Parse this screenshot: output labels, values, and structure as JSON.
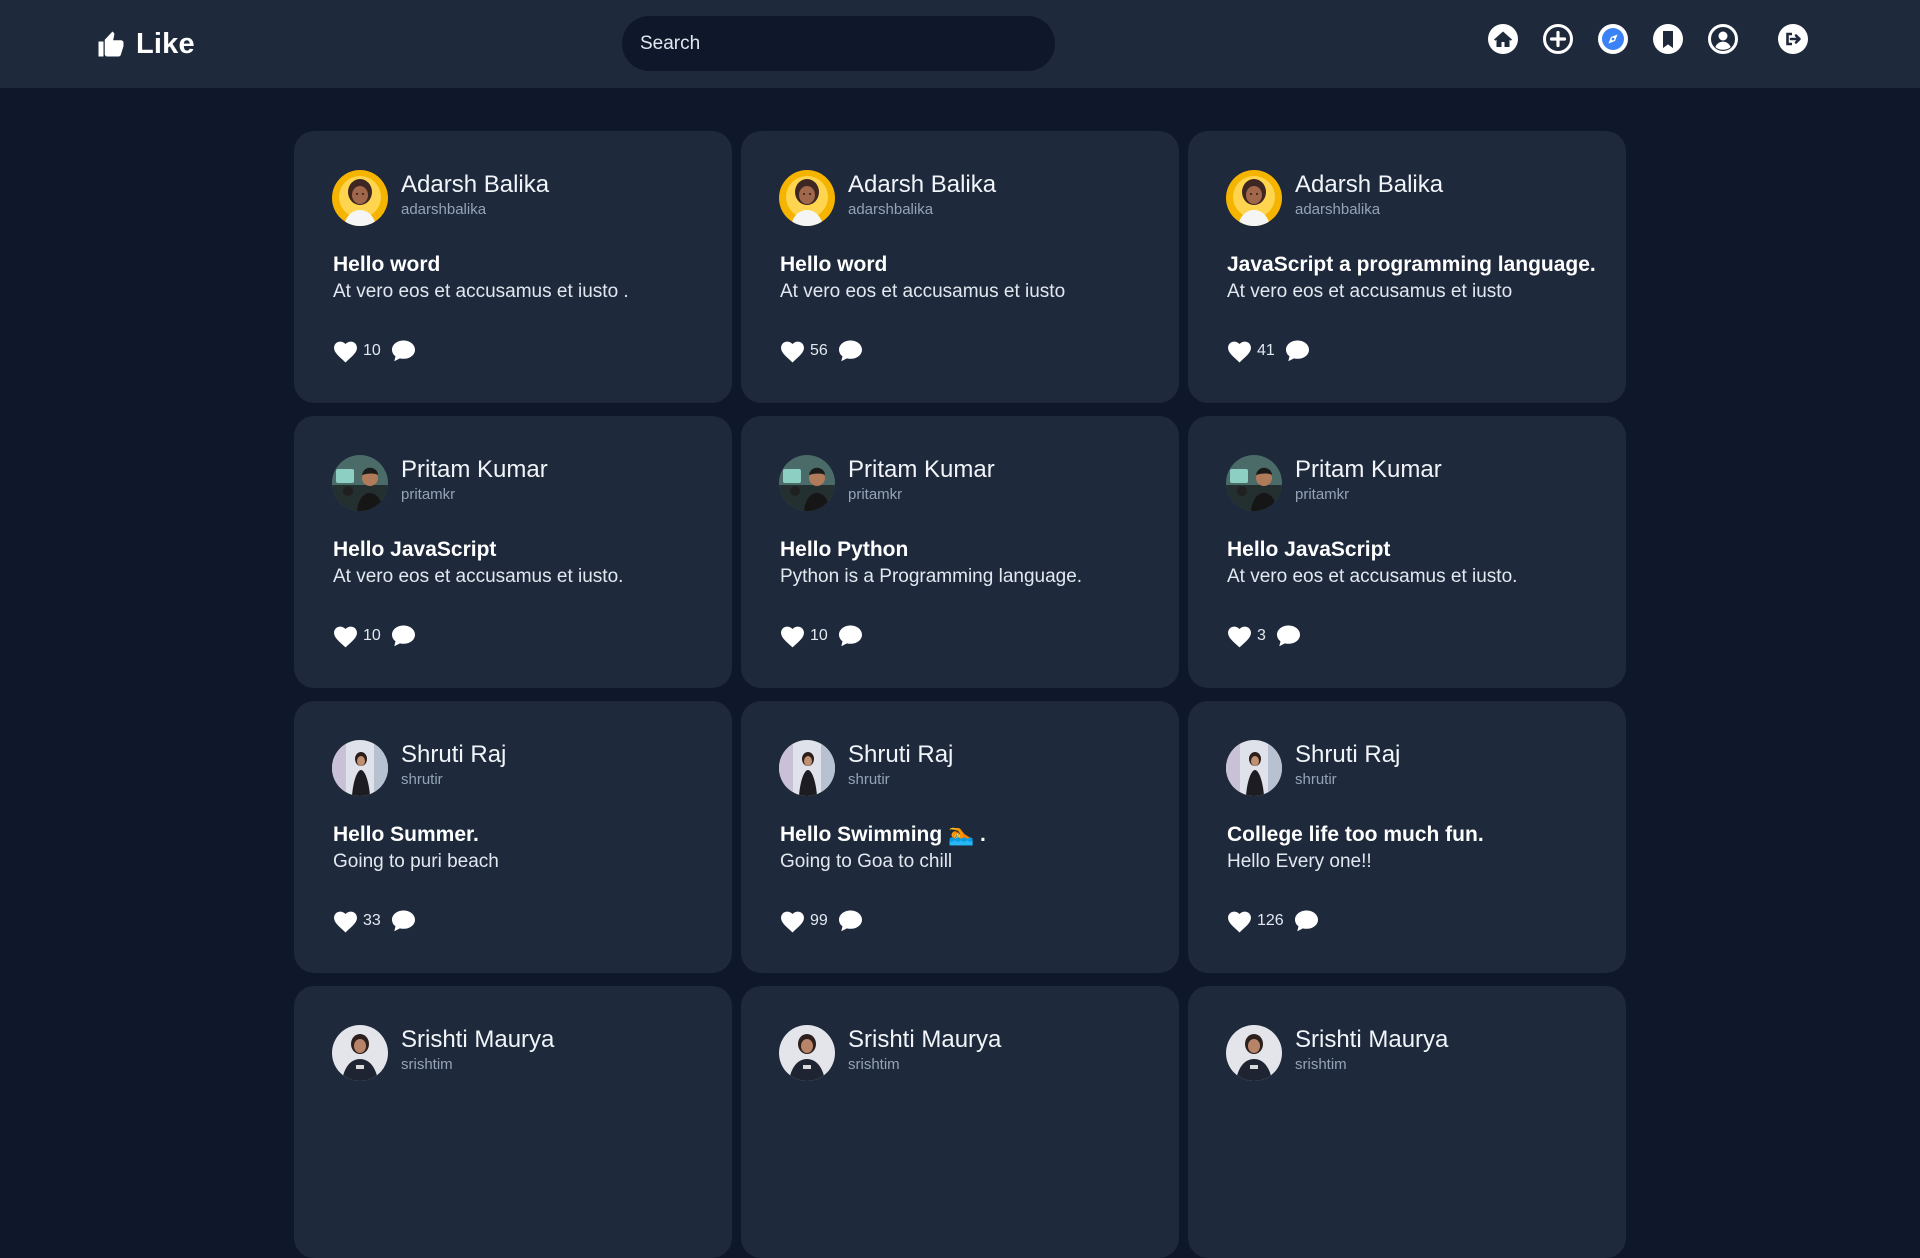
{
  "header": {
    "brand": "Like",
    "search_placeholder": "Search",
    "icons": [
      "home-icon",
      "add-post-icon",
      "explore-icon",
      "bookmark-icon",
      "profile-icon",
      "logout-icon"
    ]
  },
  "colors": {
    "background": "#0f172a",
    "surface": "#1e293b",
    "accent": "#3b82f6",
    "muted_text": "#94a3b8"
  },
  "posts": [
    {
      "name": "Adarsh Balika",
      "handle": "adarshbalika",
      "title": "Hello word",
      "body": "At vero eos et accusamus et iusto .",
      "likes": "10"
    },
    {
      "name": "Adarsh Balika",
      "handle": "adarshbalika",
      "title": "Hello word",
      "body": "At vero eos et accusamus et iusto",
      "likes": "56"
    },
    {
      "name": "Adarsh Balika",
      "handle": "adarshbalika",
      "title": "JavaScript a programming language.",
      "body": "At vero eos et accusamus et iusto",
      "likes": "41"
    },
    {
      "name": "Pritam Kumar",
      "handle": "pritamkr",
      "title": "Hello JavaScript",
      "body": "At vero eos et accusamus et iusto.",
      "likes": "10"
    },
    {
      "name": "Pritam Kumar",
      "handle": "pritamkr",
      "title": "Hello Python",
      "body": "Python is a Programming language.",
      "likes": "10"
    },
    {
      "name": "Pritam Kumar",
      "handle": "pritamkr",
      "title": "Hello JavaScript",
      "body": "At vero eos et accusamus et iusto.",
      "likes": "3"
    },
    {
      "name": "Shruti Raj",
      "handle": "shrutir",
      "title": "Hello Summer.",
      "body": "Going to puri beach",
      "likes": "33"
    },
    {
      "name": "Shruti Raj",
      "handle": "shrutir",
      "title": "Hello Swimming 🏊 .",
      "body": "Going to Goa to chill",
      "likes": "99"
    },
    {
      "name": "Shruti Raj",
      "handle": "shrutir",
      "title": "College life too much fun.",
      "body": "Hello Every one!!",
      "likes": "126"
    },
    {
      "name": "Srishti Maurya",
      "handle": "srishtim",
      "title": "",
      "body": "",
      "likes": ""
    },
    {
      "name": "Srishti Maurya",
      "handle": "srishtim",
      "title": "",
      "body": "",
      "likes": ""
    },
    {
      "name": "Srishti Maurya",
      "handle": "srishtim",
      "title": "",
      "body": "",
      "likes": ""
    }
  ]
}
